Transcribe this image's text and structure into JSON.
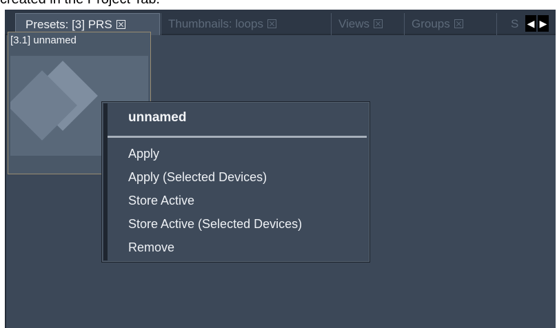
{
  "caption": "created in the Project Tab.",
  "tabs": [
    {
      "label": "Presets: [3] PRS"
    },
    {
      "label": "Thumbnails: loops"
    },
    {
      "label": "Views"
    },
    {
      "label": "Groups"
    },
    {
      "label": "S"
    }
  ],
  "scroll_left_icon": "triangle-left",
  "scroll_right_icon": "triangle-right",
  "preset": {
    "label": "[3.1] unnamed",
    "diamond_colors": [
      "#6f7e90",
      "#7f8ea0"
    ]
  },
  "context_menu": {
    "title": "unnamed",
    "items": [
      {
        "label": "Apply"
      },
      {
        "label": "Apply (Selected Devices)"
      },
      {
        "label": "Store Active"
      },
      {
        "label": "Store Active (Selected Devices)"
      },
      {
        "label": "Remove"
      }
    ]
  }
}
